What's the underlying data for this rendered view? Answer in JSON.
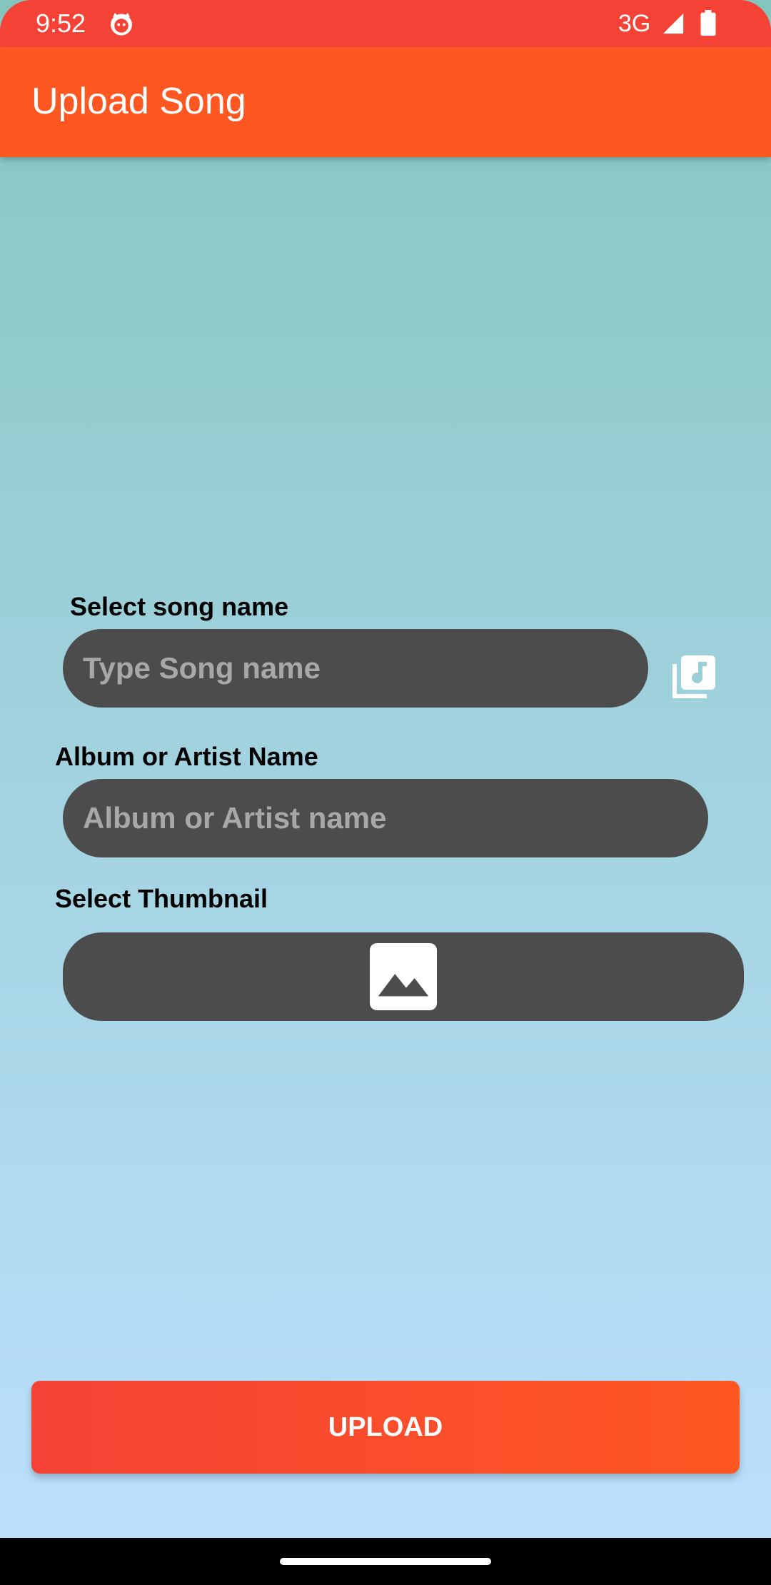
{
  "status_bar": {
    "time": "9:52",
    "network": "3G",
    "icons": [
      "cat-notification-icon",
      "signal-icon",
      "battery-icon"
    ]
  },
  "app_bar": {
    "title": "Upload Song"
  },
  "form": {
    "song_name": {
      "label": "Select song name",
      "placeholder": "Type Song name",
      "value": ""
    },
    "music_library_icon": "music-library-icon",
    "artist": {
      "label": "Album or Artist Name",
      "placeholder": "Album or Artist name",
      "value": ""
    },
    "thumbnail": {
      "label": "Select Thumbnail",
      "icon": "image-icon"
    }
  },
  "upload_button": {
    "label": "UPLOAD"
  },
  "colors": {
    "status_bar": "#F44336",
    "app_bar": "#FF5722",
    "field_background": "#4C4C4C",
    "placeholder_text": "#A8A8A8",
    "upload_gradient_start": "#F44336",
    "upload_gradient_end": "#FF5722",
    "background_top": "#84C6BE",
    "background_bottom": "#BDE0FF"
  }
}
